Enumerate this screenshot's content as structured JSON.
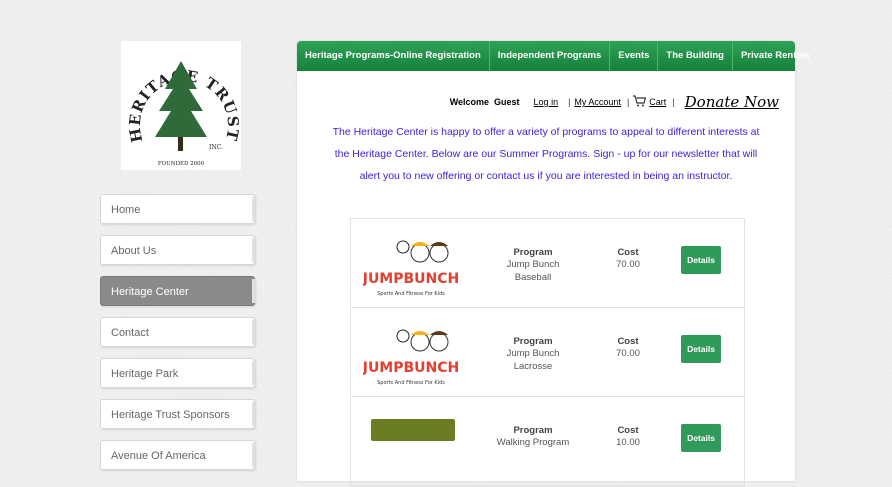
{
  "logo": {
    "text": "HERITAGE TRUST",
    "inc": "INC.",
    "founded": "FOUNDED 2000"
  },
  "sidebar": {
    "items": [
      {
        "label": "Home",
        "active": false
      },
      {
        "label": "About Us",
        "active": false
      },
      {
        "label": "Heritage Center",
        "active": true
      },
      {
        "label": "Contact",
        "active": false
      },
      {
        "label": "Heritage Park",
        "active": false
      },
      {
        "label": "Heritage Trust Sponsors",
        "active": false
      },
      {
        "label": "Avenue Of America",
        "active": false
      }
    ]
  },
  "topnav": {
    "tabs": [
      {
        "label": "Heritage Programs-Online Registration"
      },
      {
        "label": "Independent Programs"
      },
      {
        "label": "Events"
      },
      {
        "label": "The Building"
      },
      {
        "label": "Private Rentals"
      }
    ]
  },
  "userbar": {
    "welcome": "Welcome  Guest",
    "login": "Log in",
    "account": "My Account",
    "cart": "Cart",
    "donate": "Donate Now",
    "sep": "|"
  },
  "intro": "The Heritage Center is happy to offer a variety of programs to appeal to different interests at the Heritage Center. Below are our Summer Programs. Sign - up for our newsletter that will alert you to new offering or contact us if you are interested in being an instructor.",
  "programs": {
    "program_header": "Program",
    "cost_header": "Cost",
    "details_label": "Details",
    "rows": [
      {
        "name": "Jump Bunch",
        "sub": "Baseball",
        "cost": "70.00",
        "logo_text": "JUMPBUNCH",
        "logo_tag": "Sports And Fitness For Kids"
      },
      {
        "name": "Jump Bunch",
        "sub": "Lacrosse",
        "cost": "70.00",
        "logo_text": "JUMPBUNCH",
        "logo_tag": "Sports And Fitness For Kids"
      },
      {
        "name": "Walking Program",
        "sub": "",
        "cost": "10.00",
        "logo_text": "",
        "logo_tag": ""
      }
    ]
  },
  "colors": {
    "nav_green": "#16813b",
    "intro_text": "#3a1fe0",
    "details_btn": "#2f9a5a",
    "active_side": "#8a8a8a"
  }
}
